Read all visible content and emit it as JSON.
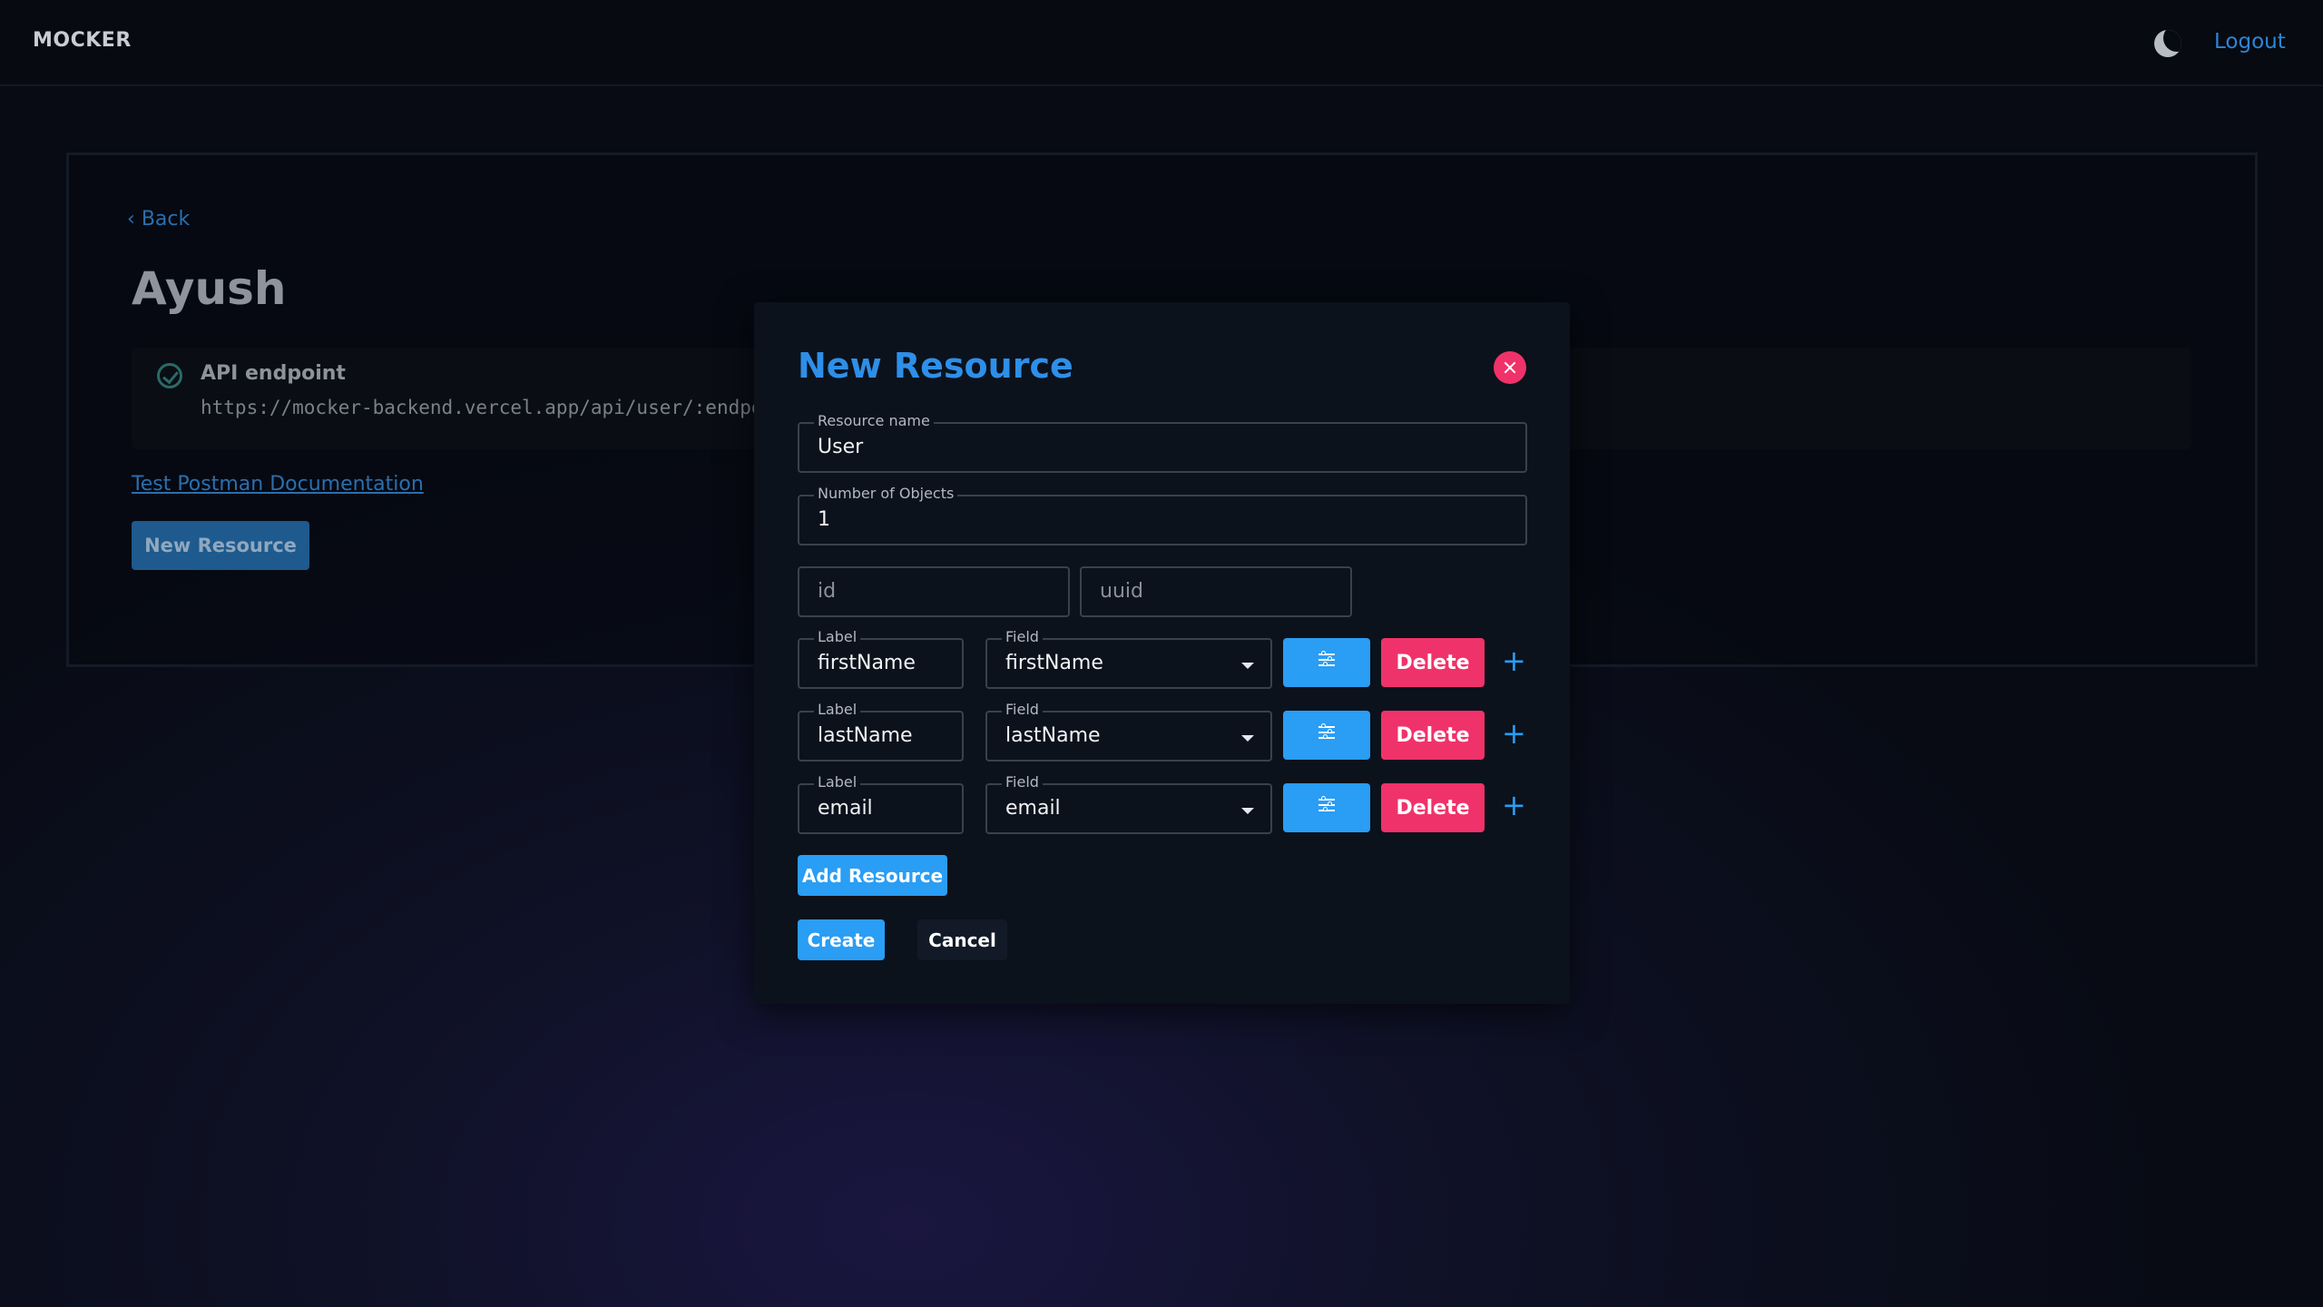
{
  "nav": {
    "logo": "MOCKER",
    "theme_icon": "moon-icon",
    "logout": "Logout"
  },
  "project": {
    "back": "Back",
    "title": "Ayush",
    "endpoint_label": "API endpoint",
    "endpoint_url": "https://mocker-backend.vercel.app/api/user/:endpo",
    "postman_link": "Test Postman Documentation",
    "new_resource_button": "New Resource"
  },
  "modal": {
    "title": "New Resource",
    "resource_name_label": "Resource name",
    "resource_name_value": "User",
    "num_objects_label": "Number of Objects",
    "num_objects_value": "1",
    "fixed_fields": [
      "id",
      "uuid"
    ],
    "row_label_legend": "Label",
    "row_field_legend": "Field",
    "rows": [
      {
        "label": "firstName",
        "field": "firstName"
      },
      {
        "label": "lastName",
        "field": "lastName"
      },
      {
        "label": "email",
        "field": "email"
      }
    ],
    "delete_label": "Delete",
    "plus": "+",
    "add_resource": "Add Resource",
    "create": "Create",
    "cancel": "Cancel"
  },
  "colors": {
    "accent": "#2a9df4",
    "danger": "#f0326a",
    "title_blue": "#2e8fe8"
  }
}
